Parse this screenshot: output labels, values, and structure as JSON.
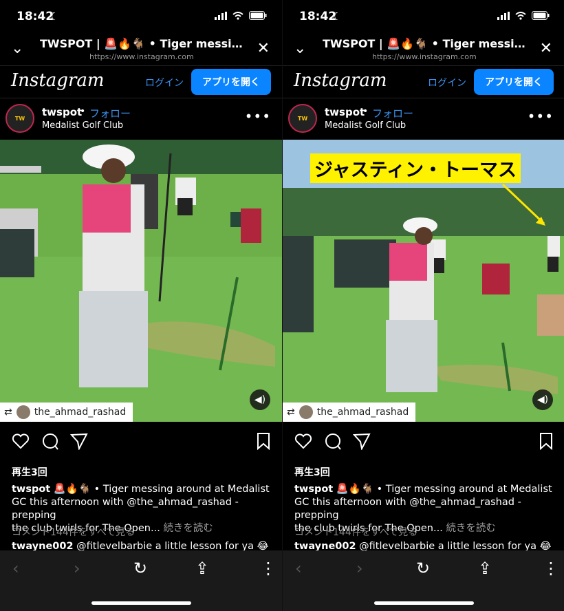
{
  "status": {
    "time": "18:42"
  },
  "browser": {
    "title": "TWSPOT | 🚨🔥🐐 • Tiger messing a...",
    "url": "https://www.instagram.com"
  },
  "instagram": {
    "logo": "Instagram",
    "login": "ログイン",
    "open_app": "アプリを開く"
  },
  "post": {
    "username": "twspot",
    "follow": "フォロー",
    "location": "Medalist Golf Club",
    "tagged_user": "the_ahmad_rashad",
    "overlay_label": "ジャスティン・トーマス",
    "views": "再生3回",
    "caption_user": "twspot",
    "caption_line1": " 🚨🔥🐐 • Tiger messing around at Medalist",
    "caption_line2": "GC this afternoon with @the_ahmad_rashad - prepping",
    "caption_line3": "the club twirls for The Open...",
    "caption_more": "続きを読む",
    "view_comments": "コメント144件をすべて見る",
    "comment_user": "twayne002",
    "comment_text": "@fitlevelbarbie a little lesson for ya 😂"
  },
  "icons": [
    "moon-icon",
    "signal-icon",
    "wifi-icon",
    "battery-icon",
    "chevron-down-icon",
    "close-icon",
    "more-icon",
    "volume-icon",
    "repost-icon",
    "heart-icon",
    "comment-icon",
    "share-icon",
    "bookmark-icon",
    "back-icon",
    "forward-icon",
    "reload-icon",
    "share-sheet-icon",
    "menu-icon"
  ]
}
